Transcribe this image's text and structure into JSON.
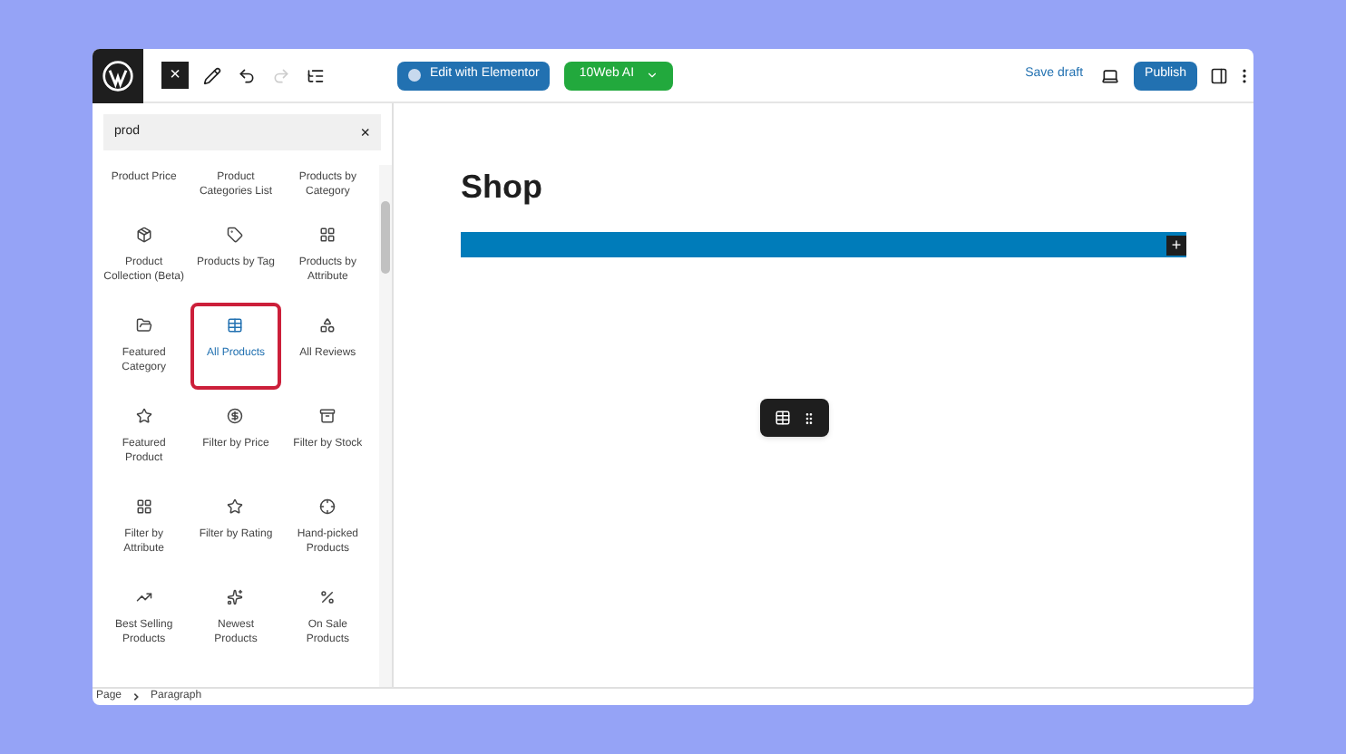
{
  "toolbar": {
    "close": "×",
    "edit_button": "Edit with Elementor",
    "ai_button": "10Web AI",
    "undo": {
      "disabled": false
    },
    "redo": {
      "disabled": true
    },
    "save_draft": "Save draft",
    "publish": "Publish"
  },
  "inserter": {
    "search": {
      "value": "prod",
      "clear": "×"
    },
    "blocks": [
      {
        "label": "Product Price",
        "selected": false
      },
      {
        "label": "Product Categories List",
        "selected": false
      },
      {
        "label": "Products by Category",
        "selected": false
      },
      {
        "label": "Product Collection (Beta)",
        "selected": false
      },
      {
        "label": "Products by Tag",
        "selected": false
      },
      {
        "label": "Products by Attribute",
        "selected": false
      },
      {
        "label": "Featured Category",
        "selected": false
      },
      {
        "label": "All Products",
        "selected": true
      },
      {
        "label": "All Reviews",
        "selected": false
      },
      {
        "label": "Featured Product",
        "selected": false
      },
      {
        "label": "Filter by Price",
        "selected": false
      },
      {
        "label": "Filter by Stock",
        "selected": false
      },
      {
        "label": "Filter by Attribute",
        "selected": false
      },
      {
        "label": "Filter by Rating",
        "selected": false
      },
      {
        "label": "Hand-picked Products",
        "selected": false
      },
      {
        "label": "Best Selling Products",
        "selected": false
      },
      {
        "label": "Newest Products",
        "selected": false
      },
      {
        "label": "On Sale Products",
        "selected": false
      }
    ]
  },
  "canvas": {
    "title": "Shop",
    "add_block": "+"
  },
  "breadcrumb": [
    "Page",
    "Paragraph"
  ]
}
